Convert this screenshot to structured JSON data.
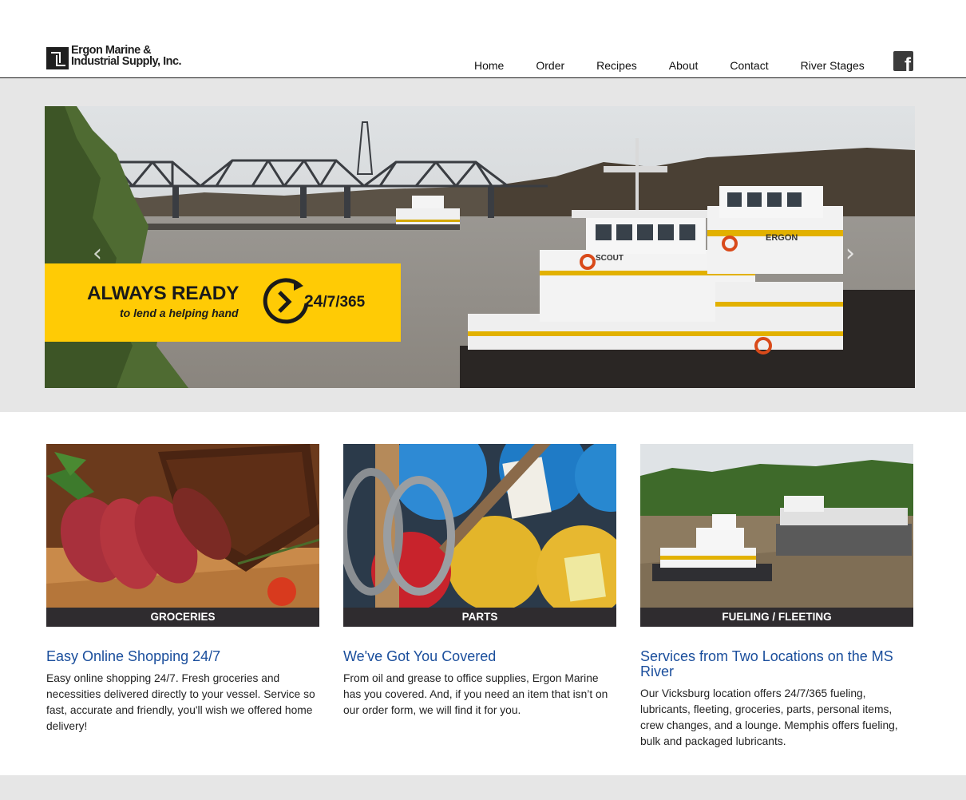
{
  "header": {
    "logo_line1": "Ergon Marine &",
    "logo_line2": "Industrial Supply, Inc.",
    "nav": [
      "Home",
      "Order",
      "Recipes",
      "About",
      "Contact",
      "River Stages"
    ],
    "facebook_glyph": "f"
  },
  "hero": {
    "banner_title": "ALWAYS READY",
    "banner_subtitle": "to lend a helping hand",
    "banner_24": "24",
    "banner_rest": "/7/365",
    "boat_name_1": "SCOUT",
    "boat_name_2": "ERGON",
    "prev_glyph": "‹",
    "next_glyph": "›",
    "banner_color": "#ffcb05"
  },
  "cards": [
    {
      "label": "GROCERIES",
      "title": "Easy Online Shopping 24/7",
      "text": "Easy online shopping 24/7. Fresh groceries and necessities delivered directly to your vessel. Service so fast, accurate and friendly, you'll wish we offered home delivery!"
    },
    {
      "label": "PARTS",
      "title": "We've Got You Covered",
      "text": "From oil and grease to office supplies, Ergon Marine has you covered. And, if you need an item that isn’t on our order form, we will find it for you."
    },
    {
      "label": "FUELING / FLEETING",
      "title": "Services from Two Locations on the MS River",
      "text": "Our Vicksburg location offers 24/7/365 fueling, lubricants, fleeting, groceries, parts, personal items, crew changes, and a lounge. Memphis offers fueling, bulk and packaged lubricants."
    }
  ],
  "colors": {
    "link_blue": "#1a4e9c",
    "label_bg": "#2f2c2f",
    "band_gray": "#e6e6e6"
  }
}
